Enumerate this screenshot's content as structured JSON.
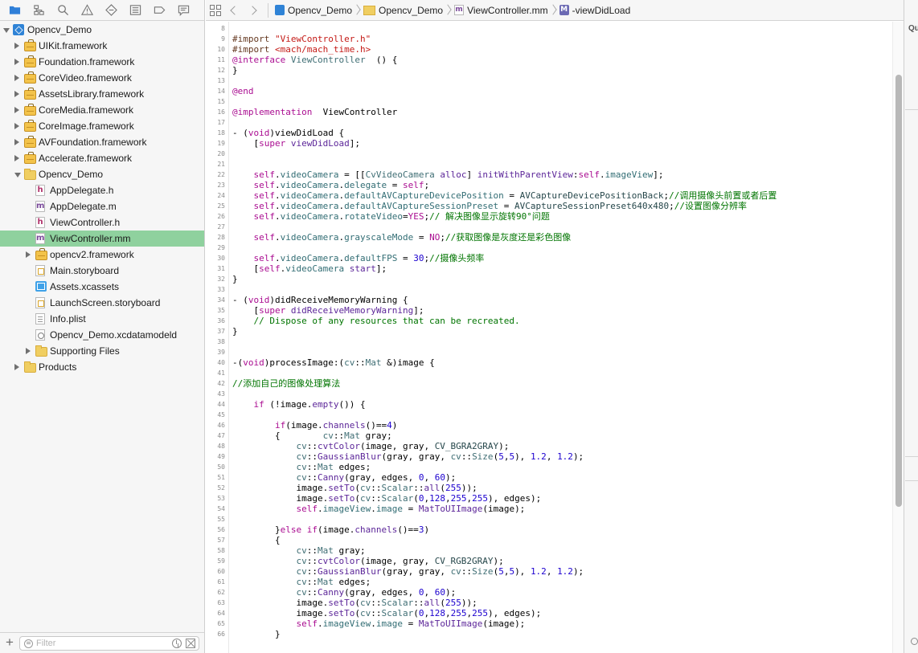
{
  "navigator": {
    "toolbar_icons": [
      "folder-icon",
      "hierarchy-icon",
      "search-icon",
      "warning-icon",
      "diamond-icon",
      "list-icon",
      "tag-icon",
      "message-icon"
    ],
    "items": [
      {
        "label": "Opencv_Demo",
        "icon": "project-icon",
        "level": 0,
        "disclosure": "open",
        "selected": false
      },
      {
        "label": "UIKit.framework",
        "icon": "framework-icon",
        "level": 1,
        "disclosure": "closed",
        "selected": false
      },
      {
        "label": "Foundation.framework",
        "icon": "framework-icon",
        "level": 1,
        "disclosure": "closed",
        "selected": false
      },
      {
        "label": "CoreVideo.framework",
        "icon": "framework-icon",
        "level": 1,
        "disclosure": "closed",
        "selected": false
      },
      {
        "label": "AssetsLibrary.framework",
        "icon": "framework-icon",
        "level": 1,
        "disclosure": "closed",
        "selected": false
      },
      {
        "label": "CoreMedia.framework",
        "icon": "framework-icon",
        "level": 1,
        "disclosure": "closed",
        "selected": false
      },
      {
        "label": "CoreImage.framework",
        "icon": "framework-icon",
        "level": 1,
        "disclosure": "closed",
        "selected": false
      },
      {
        "label": "AVFoundation.framework",
        "icon": "framework-icon",
        "level": 1,
        "disclosure": "closed",
        "selected": false
      },
      {
        "label": "Accelerate.framework",
        "icon": "framework-icon",
        "level": 1,
        "disclosure": "closed",
        "selected": false
      },
      {
        "label": "Opencv_Demo",
        "icon": "folder-icon",
        "level": 1,
        "disclosure": "open",
        "selected": false
      },
      {
        "label": "AppDelegate.h",
        "icon": "h-file-icon",
        "level": 2,
        "disclosure": "none",
        "selected": false
      },
      {
        "label": "AppDelegate.m",
        "icon": "m-file-icon",
        "level": 2,
        "disclosure": "none",
        "selected": false
      },
      {
        "label": "ViewController.h",
        "icon": "h-file-icon",
        "level": 2,
        "disclosure": "none",
        "selected": false
      },
      {
        "label": "ViewController.mm",
        "icon": "mm-file-icon",
        "level": 2,
        "disclosure": "none",
        "selected": true
      },
      {
        "label": "opencv2.framework",
        "icon": "framework-icon",
        "level": 2,
        "disclosure": "closed",
        "selected": false
      },
      {
        "label": "Main.storyboard",
        "icon": "storyboard-icon",
        "level": 2,
        "disclosure": "none",
        "selected": false
      },
      {
        "label": "Assets.xcassets",
        "icon": "assets-icon",
        "level": 2,
        "disclosure": "none",
        "selected": false
      },
      {
        "label": "LaunchScreen.storyboard",
        "icon": "storyboard-icon",
        "level": 2,
        "disclosure": "none",
        "selected": false
      },
      {
        "label": "Info.plist",
        "icon": "plist-icon",
        "level": 2,
        "disclosure": "none",
        "selected": false
      },
      {
        "label": "Opencv_Demo.xcdatamodeld",
        "icon": "datamodel-icon",
        "level": 2,
        "disclosure": "none",
        "selected": false
      },
      {
        "label": "Supporting Files",
        "icon": "folder-icon",
        "level": 2,
        "disclosure": "closed",
        "selected": false
      },
      {
        "label": "Products",
        "icon": "folder-icon",
        "level": 1,
        "disclosure": "closed",
        "selected": false
      }
    ],
    "filter": {
      "placeholder": "Filter",
      "value": ""
    },
    "add_label": "+"
  },
  "jumpbar": {
    "crumbs": [
      {
        "label": "Opencv_Demo",
        "icon": "project-icon"
      },
      {
        "label": "Opencv_Demo",
        "icon": "folder-icon"
      },
      {
        "label": "ViewController.mm",
        "icon": "mm-file-icon",
        "badge": "m"
      },
      {
        "label": "-viewDidLoad",
        "icon": "method-icon",
        "badge": "M"
      }
    ]
  },
  "inspector": {
    "header": "Qu"
  },
  "editor": {
    "lines": [
      {
        "n": 8,
        "t": ""
      },
      {
        "n": 9,
        "t": "[pp]#import [str]\"ViewController.h\""
      },
      {
        "n": 10,
        "t": "[pp]#import [str]<mach/mach_time.h>"
      },
      {
        "n": 11,
        "t": "[kw]@interface [typ]ViewController [] () {"
      },
      {
        "n": 12,
        "t": "}"
      },
      {
        "n": 13,
        "t": ""
      },
      {
        "n": 14,
        "t": "[kw]@end"
      },
      {
        "n": 15,
        "t": ""
      },
      {
        "n": 16,
        "t": "[kw]@implementation [] ViewController"
      },
      {
        "n": 17,
        "t": ""
      },
      {
        "n": 18,
        "t": "- ([kw]void[])viewDidLoad {"
      },
      {
        "n": 19,
        "t": "    [[kw]super [pj]viewDidLoad[]];"
      },
      {
        "n": 20,
        "t": ""
      },
      {
        "n": 21,
        "t": ""
      },
      {
        "n": 22,
        "t": "    [kw]self[].[mt]videoCamera[] = [[[typ]CvVideoCamera [pj]alloc[]] [pj]initWithParentView[]:[kw]self[].[mt]imageView[]];"
      },
      {
        "n": 23,
        "t": "    [kw]self[].[mt]videoCamera[].[mt]delegate[] = [kw]self[];"
      },
      {
        "n": 24,
        "t": "    [kw]self[].[mt]videoCamera[].[mt]defaultAVCaptureDevicePosition[] = [tm]AVCaptureDevicePositionBack[];[cm]//调用摄像头前置或者后置"
      },
      {
        "n": 25,
        "t": "    [kw]self[].[mt]videoCamera[].[mt]defaultAVCaptureSessionPreset[] = [tm]AVCaptureSessionPreset640x480[];[cm]//设置图像分辨率"
      },
      {
        "n": 26,
        "t": "    [kw]self[].[mt]videoCamera[].[mt]rotateVideo[]=[kw]YES[];[cm]// 解决图像显示旋转90°问题"
      },
      {
        "n": 27,
        "t": ""
      },
      {
        "n": 28,
        "t": "    [kw]self[].[mt]videoCamera[].[mt]grayscaleMode[] = [kw]NO[];[cm]//获取图像是灰度还是彩色图像"
      },
      {
        "n": 29,
        "t": ""
      },
      {
        "n": 30,
        "t": "    [kw]self[].[mt]videoCamera[].[mt]defaultFPS[] = [nm]30[];[cm]//摄像头频率"
      },
      {
        "n": 31,
        "t": "    [[kw]self[].[mt]videoCamera[] [pj]start[]];"
      },
      {
        "n": 32,
        "t": "}"
      },
      {
        "n": 33,
        "t": ""
      },
      {
        "n": 34,
        "t": "- ([kw]void[])didReceiveMemoryWarning {"
      },
      {
        "n": 35,
        "t": "    [[kw]super [pj]didReceiveMemoryWarning[]];"
      },
      {
        "n": 36,
        "t": "    [cm]// Dispose of any resources that can be recreated."
      },
      {
        "n": 37,
        "t": "}"
      },
      {
        "n": 38,
        "t": ""
      },
      {
        "n": 39,
        "t": ""
      },
      {
        "n": 40,
        "t": "-([kw]void[])processImage:([typ]cv[]::[typ]Mat[] &)image {"
      },
      {
        "n": 41,
        "t": ""
      },
      {
        "n": 42,
        "t": "[cm]//添加自己的图像处理算法"
      },
      {
        "n": 43,
        "t": ""
      },
      {
        "n": 44,
        "t": "    [kw]if[] (!image.[pj]empty[]()) {"
      },
      {
        "n": 45,
        "t": ""
      },
      {
        "n": 46,
        "t": "        [kw]if[](image.[pj]channels[]()==[nm]4[])"
      },
      {
        "n": 47,
        "t": "        {        [typ]cv[]::[typ]Mat[] gray;"
      },
      {
        "n": 48,
        "t": "            [typ]cv[]::[pj]cvtColor[](image, gray, [tm]CV_BGRA2GRAY[]);"
      },
      {
        "n": 49,
        "t": "            [typ]cv[]::[pj]GaussianBlur[](gray, gray, [typ]cv[]::[typ]Size[]([nm]5[],[nm]5[]), [nm]1.2[], [nm]1.2[]);"
      },
      {
        "n": 50,
        "t": "            [typ]cv[]::[typ]Mat[] edges;"
      },
      {
        "n": 51,
        "t": "            [typ]cv[]::[pj]Canny[](gray, edges, [nm]0[], [nm]60[]);"
      },
      {
        "n": 52,
        "t": "            image.[pj]setTo[]([typ]cv[]::[typ]Scalar[]::[pj]all[]([nm]255[]));"
      },
      {
        "n": 53,
        "t": "            image.[pj]setTo[]([typ]cv[]::[typ]Scalar[]([nm]0[],[nm]128[],[nm]255[],[nm]255[]), edges);"
      },
      {
        "n": 54,
        "t": "            [kw]self[].[mt]imageView[].[mt]image[] = [pj]MatToUIImage[](image);"
      },
      {
        "n": 55,
        "t": ""
      },
      {
        "n": 56,
        "t": "        }[kw]else if[](image.[pj]channels[]()==[nm]3[])"
      },
      {
        "n": 57,
        "t": "        {"
      },
      {
        "n": 58,
        "t": "            [typ]cv[]::[typ]Mat[] gray;"
      },
      {
        "n": 59,
        "t": "            [typ]cv[]::[pj]cvtColor[](image, gray, [tm]CV_RGB2GRAY[]);"
      },
      {
        "n": 60,
        "t": "            [typ]cv[]::[pj]GaussianBlur[](gray, gray, [typ]cv[]::[typ]Size[]([nm]5[],[nm]5[]), [nm]1.2[], [nm]1.2[]);"
      },
      {
        "n": 61,
        "t": "            [typ]cv[]::[typ]Mat[] edges;"
      },
      {
        "n": 62,
        "t": "            [typ]cv[]::[pj]Canny[](gray, edges, [nm]0[], [nm]60[]);"
      },
      {
        "n": 63,
        "t": "            image.[pj]setTo[]([typ]cv[]::[typ]Scalar[]::[pj]all[]([nm]255[]));"
      },
      {
        "n": 64,
        "t": "            image.[pj]setTo[]([typ]cv[]::[typ]Scalar[]([nm]0[],[nm]128[],[nm]255[],[nm]255[]), edges);"
      },
      {
        "n": 65,
        "t": "            [kw]self[].[mt]imageView[].[mt]image[] = [pj]MatToUIImage[](image);"
      },
      {
        "n": 66,
        "t": "        }"
      }
    ]
  }
}
